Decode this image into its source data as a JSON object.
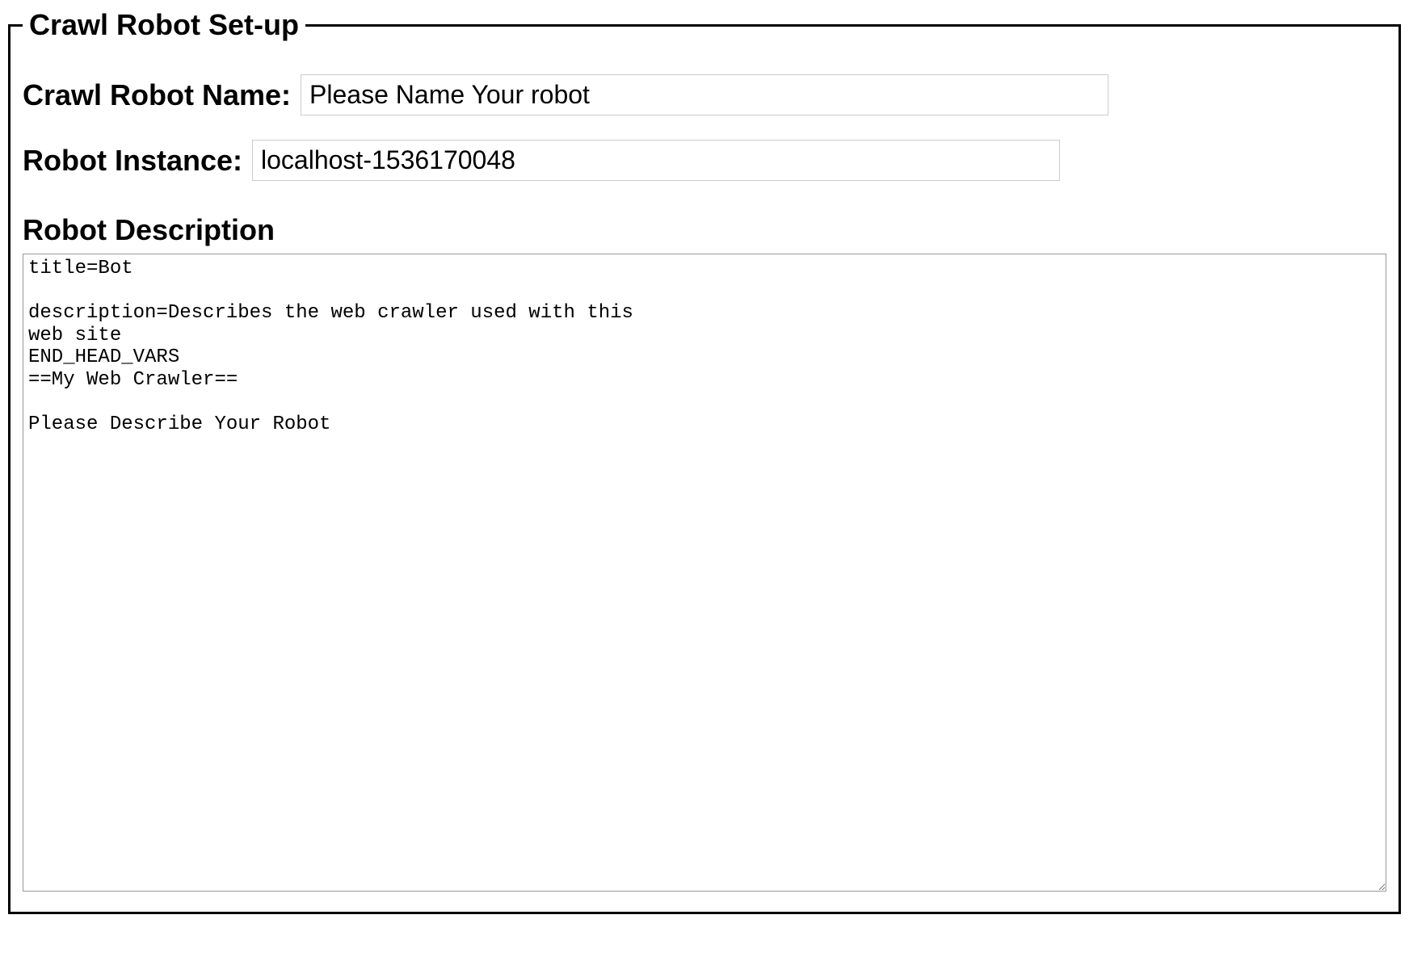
{
  "fieldset": {
    "legend": "Crawl Robot Set-up"
  },
  "robot_name": {
    "label": "Crawl Robot Name:",
    "value": "Please Name Your robot"
  },
  "robot_instance": {
    "label": "Robot Instance:",
    "value": "localhost-1536170048"
  },
  "robot_description": {
    "heading": "Robot Description",
    "value": "title=Bot\n\ndescription=Describes the web crawler used with this\nweb site\nEND_HEAD_VARS\n==My Web Crawler==\n\nPlease Describe Your Robot"
  }
}
